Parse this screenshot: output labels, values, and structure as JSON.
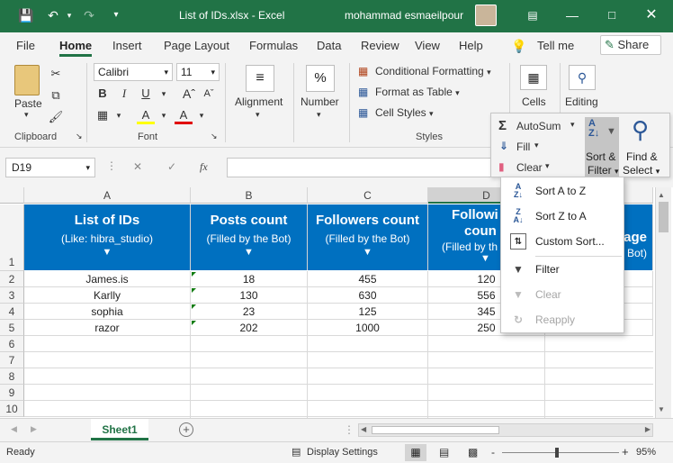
{
  "title": {
    "file": "List of IDs.xlsx",
    "sep": "-",
    "app": "Excel",
    "user": "mohammad esmaeilpour"
  },
  "tabs": [
    "File",
    "Home",
    "Insert",
    "Page Layout",
    "Formulas",
    "Data",
    "Review",
    "View",
    "Help"
  ],
  "tellme": "Tell me",
  "share": "Share",
  "ribbon": {
    "clipboard": {
      "paste": "Paste",
      "label": "Clipboard"
    },
    "font": {
      "name": "Calibri",
      "size": "11",
      "label": "Font",
      "bold": "B",
      "italic": "I",
      "underline": "U",
      "fontcolor": "A",
      "fillcolor": "A"
    },
    "alignment": "Alignment",
    "number": "Number",
    "percent": "%",
    "styles": {
      "conditional": "Conditional Formatting",
      "table": "Format as Table",
      "cell": "Cell Styles",
      "label": "Styles"
    },
    "cells": "Cells",
    "editing": "Editing"
  },
  "editing_panel": {
    "autosum": "AutoSum",
    "fill": "Fill",
    "clear": "Clear",
    "sort1": "Sort &",
    "sort2": "Filter",
    "find1": "Find &",
    "find2": "Select"
  },
  "sort_menu": [
    {
      "label": "Sort A to Z",
      "enabled": true,
      "icon": "sort-az-icon"
    },
    {
      "label": "Sort Z to A",
      "enabled": true,
      "icon": "sort-za-icon"
    },
    {
      "label": "Custom Sort...",
      "enabled": true,
      "icon": "custom-sort-icon"
    },
    {
      "label": "Filter",
      "enabled": true,
      "icon": "filter-icon"
    },
    {
      "label": "Clear",
      "enabled": false,
      "icon": "clear-filter-icon"
    },
    {
      "label": "Reapply",
      "enabled": false,
      "icon": "reapply-icon"
    }
  ],
  "formula_bar": {
    "name_box": "D19",
    "fx": "fx",
    "value": ""
  },
  "columns": [
    "A",
    "B",
    "C",
    "D"
  ],
  "headers": [
    {
      "title": "List of IDs",
      "sub": "(Like: hibra_studio)"
    },
    {
      "title": "Posts count",
      "sub": "(Filled by the Bot)"
    },
    {
      "title": "Followers count",
      "sub": "(Filled by the Bot)"
    },
    {
      "title": "Followi",
      "title2": "coun",
      "sub": "(Filled by th"
    }
  ],
  "header_e": {
    "title": "age",
    "sub": "Bot)"
  },
  "rows": [
    [
      "James.is",
      "18",
      "455",
      "120"
    ],
    [
      "Karlly",
      "130",
      "630",
      "556"
    ],
    [
      "sophia",
      "23",
      "125",
      "345"
    ],
    [
      "razor",
      "202",
      "1000",
      "250"
    ]
  ],
  "row_numbers": [
    "1",
    "2",
    "3",
    "4",
    "5",
    "6",
    "7",
    "8",
    "9",
    "10"
  ],
  "sheet_tab": "Sheet1",
  "status": {
    "ready": "Ready",
    "display": "Display Settings",
    "zoom": "95%",
    "minus": "-",
    "plus": "+"
  },
  "colors": {
    "excel_green": "#217346",
    "header_blue": "#0070c0"
  }
}
